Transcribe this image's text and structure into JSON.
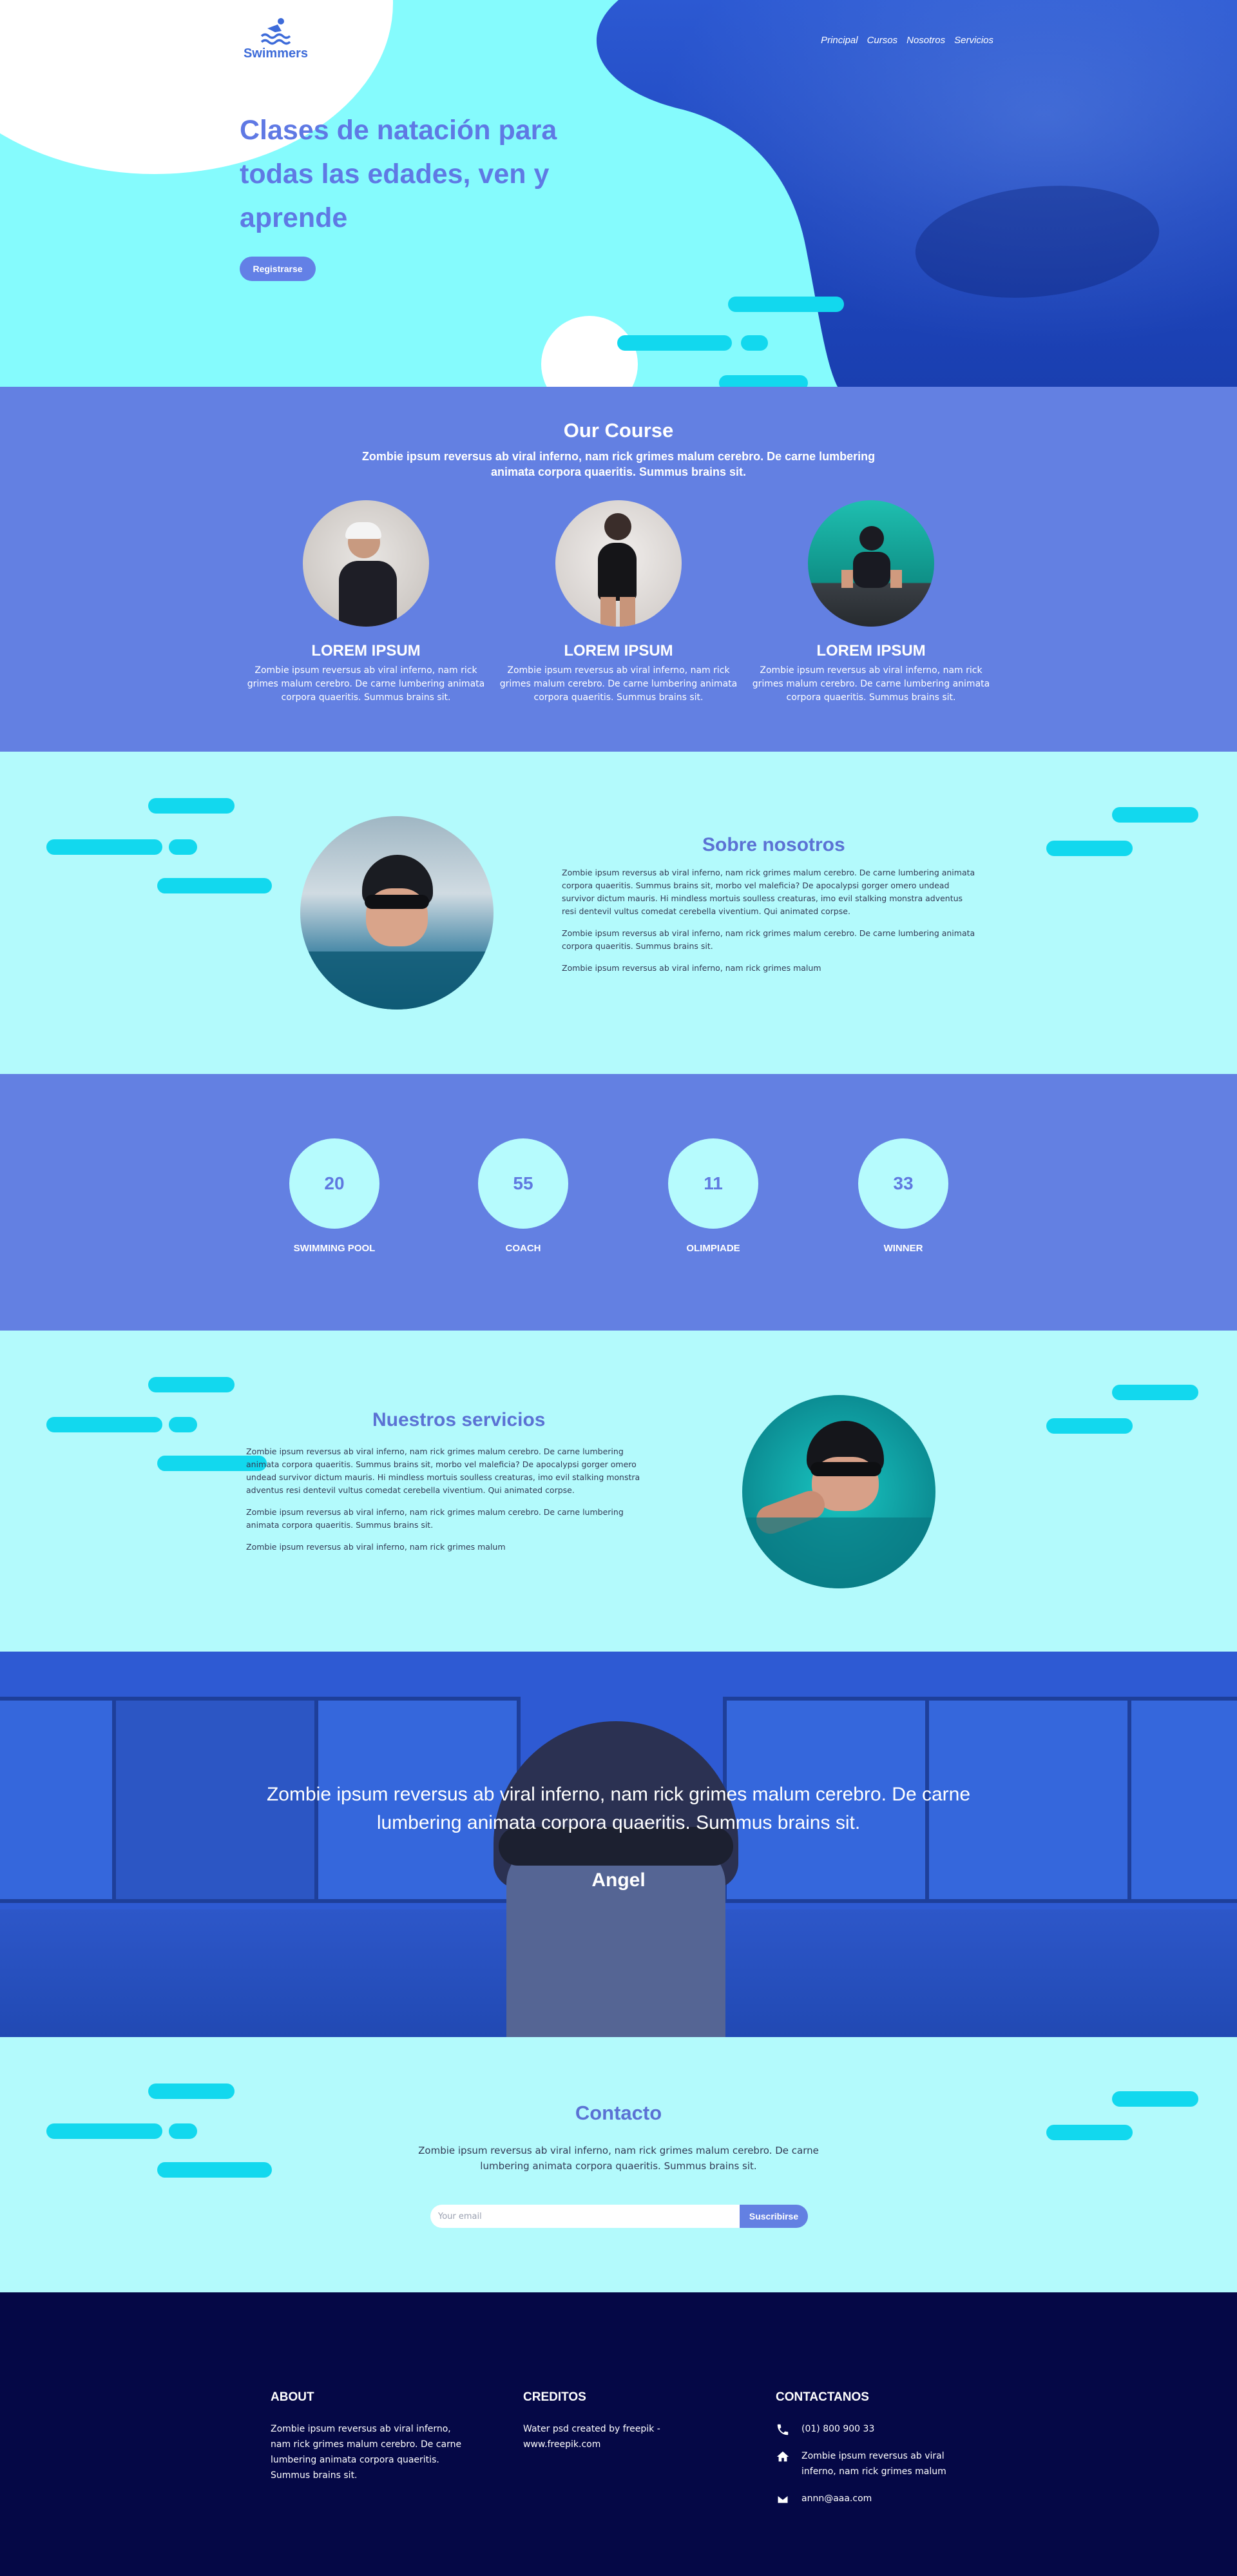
{
  "brand": {
    "name": "Swimmers",
    "logo_icon": "swimmer-icon",
    "accent": "#6380e2",
    "cyan": "#b3fafc",
    "footer_bg": "#050846"
  },
  "nav": {
    "items": [
      {
        "label": "Principal"
      },
      {
        "label": "Cursos"
      },
      {
        "label": "Nosotros"
      },
      {
        "label": "Servicios"
      }
    ]
  },
  "hero": {
    "title": "Clases de natación para todas las edades, ven y aprende",
    "cta": "Registrarse"
  },
  "course": {
    "title": "Our Course",
    "subtitle": "Zombie ipsum reversus ab viral inferno, nam rick grimes malum cerebro. De carne lumbering animata corpora quaeritis. Summus brains sit.",
    "cards": [
      {
        "title": "LOREM IPSUM",
        "text": "Zombie ipsum reversus ab viral inferno, nam rick grimes malum cerebro. De carne lumbering animata corpora quaeritis. Summus brains sit."
      },
      {
        "title": "LOREM IPSUM",
        "text": "Zombie ipsum reversus ab viral inferno, nam rick grimes malum cerebro. De carne lumbering animata corpora quaeritis. Summus brains sit."
      },
      {
        "title": "LOREM IPSUM",
        "text": "Zombie ipsum reversus ab viral inferno, nam rick grimes malum cerebro. De carne lumbering animata corpora quaeritis. Summus brains sit."
      }
    ]
  },
  "about": {
    "title": "Sobre nosotros",
    "paragraphs": [
      "Zombie ipsum reversus ab viral inferno, nam rick grimes malum cerebro. De carne lumbering animata corpora quaeritis. Summus brains sit, morbo vel maleficia? De apocalypsi gorger omero undead survivor dictum mauris. Hi mindless mortuis soulless creaturas, imo evil stalking monstra adventus resi dentevil vultus comedat cerebella viventium. Qui animated corpse.",
      "Zombie ipsum reversus ab viral inferno, nam rick grimes malum cerebro. De carne lumbering animata corpora quaeritis. Summus brains sit.",
      "Zombie ipsum reversus ab viral inferno, nam rick grimes malum"
    ]
  },
  "stats": [
    {
      "value": "20",
      "label": "SWIMMING POOL"
    },
    {
      "value": "55",
      "label": "COACH"
    },
    {
      "value": "11",
      "label": "OLIMPIADE"
    },
    {
      "value": "33",
      "label": "WINNER"
    }
  ],
  "services": {
    "title": "Nuestros servicios",
    "paragraphs": [
      "Zombie ipsum reversus ab viral inferno, nam rick grimes malum cerebro. De carne lumbering animata corpora quaeritis. Summus brains sit, morbo vel maleficia? De apocalypsi gorger omero undead survivor dictum mauris. Hi mindless mortuis soulless creaturas, imo evil stalking monstra adventus resi dentevil vultus comedat cerebella viventium. Qui animated corpse.",
      "Zombie ipsum reversus ab viral inferno, nam rick grimes malum cerebro. De carne lumbering animata corpora quaeritis. Summus brains sit.",
      "Zombie ipsum reversus ab viral inferno, nam rick grimes malum"
    ]
  },
  "testimonial": {
    "quote": "Zombie ipsum reversus ab viral inferno, nam rick grimes malum cerebro. De carne lumbering animata corpora quaeritis. Summus brains sit.",
    "name": "Angel"
  },
  "contact": {
    "title": "Contacto",
    "subtitle": "Zombie ipsum reversus ab viral inferno, nam rick grimes malum cerebro. De carne lumbering animata corpora quaeritis. Summus brains sit.",
    "email_placeholder": "Your email",
    "submit": "Suscribirse"
  },
  "footer": {
    "about": {
      "title": "ABOUT",
      "text": "Zombie ipsum reversus ab viral inferno, nam rick grimes malum cerebro. De carne lumbering animata corpora quaeritis. Summus brains sit."
    },
    "credits": {
      "title": "CREDITOS",
      "text": "Water psd created by freepik - www.freepik.com"
    },
    "contact": {
      "title": "CONTACTANOS",
      "items": [
        {
          "icon": "phone-icon",
          "text": "(01) 800 900 33"
        },
        {
          "icon": "home-icon",
          "text": "Zombie ipsum reversus ab viral inferno, nam rick grimes malum"
        },
        {
          "icon": "mail-icon",
          "text": "annn@aaa.com"
        }
      ]
    }
  }
}
